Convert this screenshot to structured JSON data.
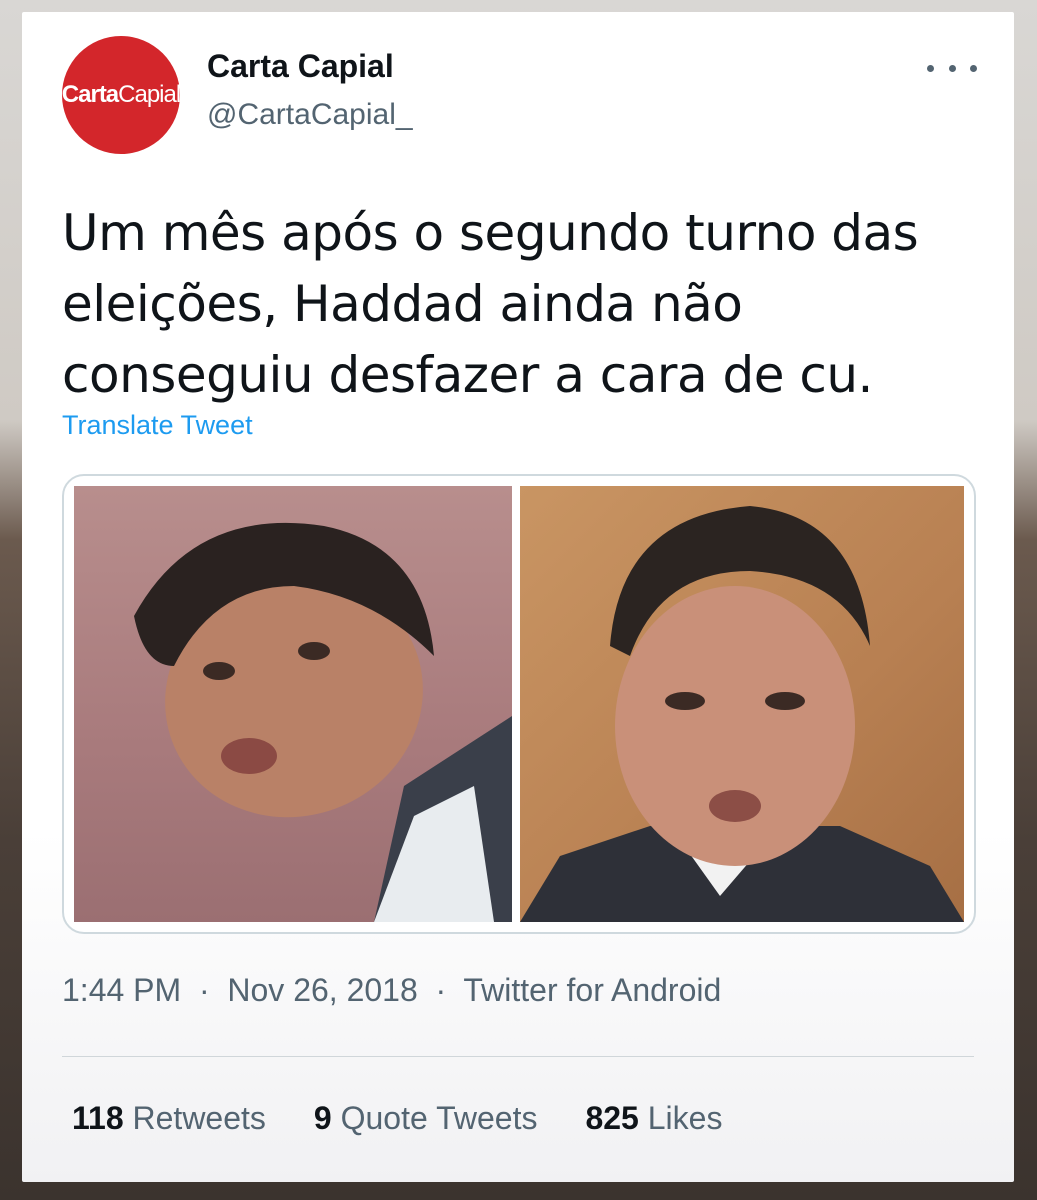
{
  "author": {
    "avatar_text_bold": "Carta",
    "avatar_text_regular": "Capial",
    "display_name": "Carta Capial",
    "handle": "@CartaCapial_"
  },
  "tweet": {
    "text": "Um mês após o segundo turno das eleições, Haddad ainda não conseguiu desfazer a cara de cu.",
    "translate_label": "Translate Tweet"
  },
  "meta": {
    "time": "1:44 PM",
    "separator": "·",
    "date": "Nov 26, 2018",
    "source": "Twitter for Android"
  },
  "stats": {
    "retweets_count": "118",
    "retweets_label": "Retweets",
    "quotes_count": "9",
    "quotes_label": "Quote Tweets",
    "likes_count": "825",
    "likes_label": "Likes"
  },
  "colors": {
    "avatar_bg": "#d3262b",
    "link": "#1d9bf0",
    "text": "#0f1419",
    "muted": "#536471"
  }
}
